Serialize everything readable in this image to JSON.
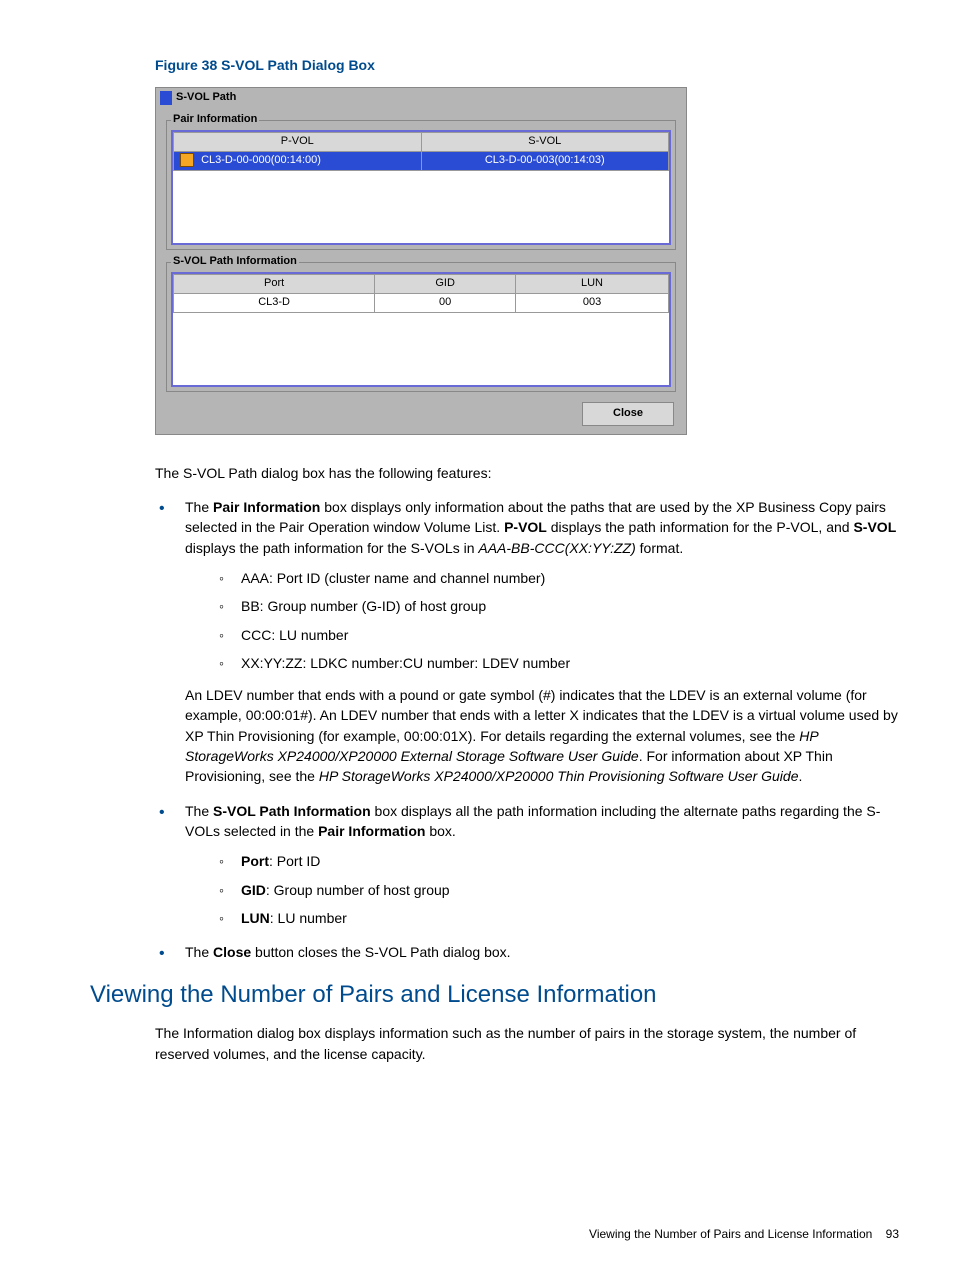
{
  "figure": {
    "caption": "Figure 38 S-VOL Path Dialog Box"
  },
  "dialog": {
    "title": "S-VOL Path",
    "pair_legend": "Pair Information",
    "pair_table": {
      "headers": {
        "pvol": "P-VOL",
        "svol": "S-VOL"
      },
      "row": {
        "pvol": "CL3-D-00-000(00:14:00)",
        "svol": "CL3-D-00-003(00:14:03)"
      }
    },
    "path_legend": "S-VOL Path Information",
    "path_table": {
      "headers": {
        "port": "Port",
        "gid": "GID",
        "lun": "LUN"
      },
      "row": {
        "port": "CL3-D",
        "gid": "00",
        "lun": "003"
      }
    },
    "close": "Close"
  },
  "intro": "The S-VOL Path dialog box has the following features:",
  "list": {
    "item1_a": "The ",
    "item1_b": "Pair Information",
    "item1_c": " box displays only information about the paths that are used by the XP Business Copy pairs selected in the Pair Operation window Volume List. ",
    "item1_d": "P-VOL",
    "item1_e": " displays the path information for the P-VOL, and ",
    "item1_f": "S-VOL",
    "item1_g": " displays the path information for the S-VOLs in ",
    "item1_h": "AAA-BB-CCC(XX:YY:ZZ)",
    "item1_i": " format.",
    "sub1": {
      "a": "AAA: Port ID (cluster name and channel number)",
      "b": "BB: Group number (G-ID) of host group",
      "c": "CCC: LU number",
      "d": "XX:YY:ZZ: LDKC number:CU number: LDEV number"
    },
    "after1_a": "An LDEV number that ends with a pound or gate symbol (#) indicates that the LDEV is an external volume (for example, 00:00:01#). An LDEV number that ends with a letter X indicates that the LDEV is a virtual volume used by XP Thin Provisioning (for example, 00:00:01X). For details regarding the external volumes, see the ",
    "after1_b": "HP StorageWorks XP24000/XP20000 External Storage Software User Guide",
    "after1_c": ". For information about XP Thin Provisioning, see the ",
    "after1_d": "HP StorageWorks XP24000/XP20000 Thin Provisioning Software User Guide",
    "after1_e": ".",
    "item2_a": "The ",
    "item2_b": "S-VOL Path Information",
    "item2_c": " box displays all the path information including the alternate paths regarding the S-VOLs selected in the ",
    "item2_d": "Pair Information",
    "item2_e": " box.",
    "sub2": {
      "a_b": "Port",
      "a_t": ": Port ID",
      "b_b": "GID",
      "b_t": ": Group number of host group",
      "c_b": "LUN",
      "c_t": ": LU number"
    },
    "item3_a": "The ",
    "item3_b": "Close",
    "item3_c": " button closes the S-VOL Path dialog box."
  },
  "section": {
    "heading": "Viewing the Number of Pairs and License Information",
    "body": "The Information dialog box displays information such as the number of pairs in the storage system, the number of reserved volumes, and the license capacity."
  },
  "footer": {
    "text": "Viewing the Number of Pairs and License Information",
    "page": "93"
  }
}
